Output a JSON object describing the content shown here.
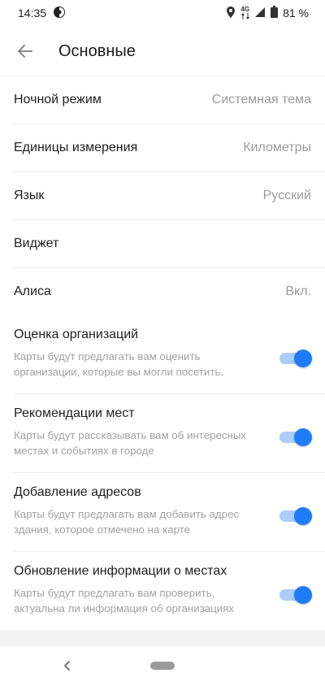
{
  "status_bar": {
    "time": "14:35",
    "network_top": "4G",
    "battery": "81 %"
  },
  "header": {
    "title": "Основные",
    "back_icon": "arrow-left-icon"
  },
  "settings": [
    {
      "title": "Ночной режим",
      "value": "Системная тема"
    },
    {
      "title": "Единицы измерения",
      "value": "Километры"
    },
    {
      "title": "Язык",
      "value": "Русский"
    },
    {
      "title": "Виджет",
      "value": ""
    },
    {
      "title": "Алиса",
      "value": "Вкл."
    }
  ],
  "toggles": [
    {
      "title": "Оценка организаций",
      "desc": "Карты будут предлагать вам оценить организации, которые вы могли посетить.",
      "on": true
    },
    {
      "title": "Рекомендации мест",
      "desc": "Карты будут рассказывать вам об интересных местах и событиях в городе",
      "on": true
    },
    {
      "title": "Добавление адресов",
      "desc": "Карты будут предлагать вам добавить адрес здания, которое отмечено на карте",
      "on": true
    },
    {
      "title": "Обновление информации о местах",
      "desc": "Карты будут предлагать вам проверить, актуальна ли информация об организациях",
      "on": true
    }
  ],
  "colors": {
    "toggle_knob": "#1f7bf6",
    "toggle_track": "#a9cdfd"
  }
}
